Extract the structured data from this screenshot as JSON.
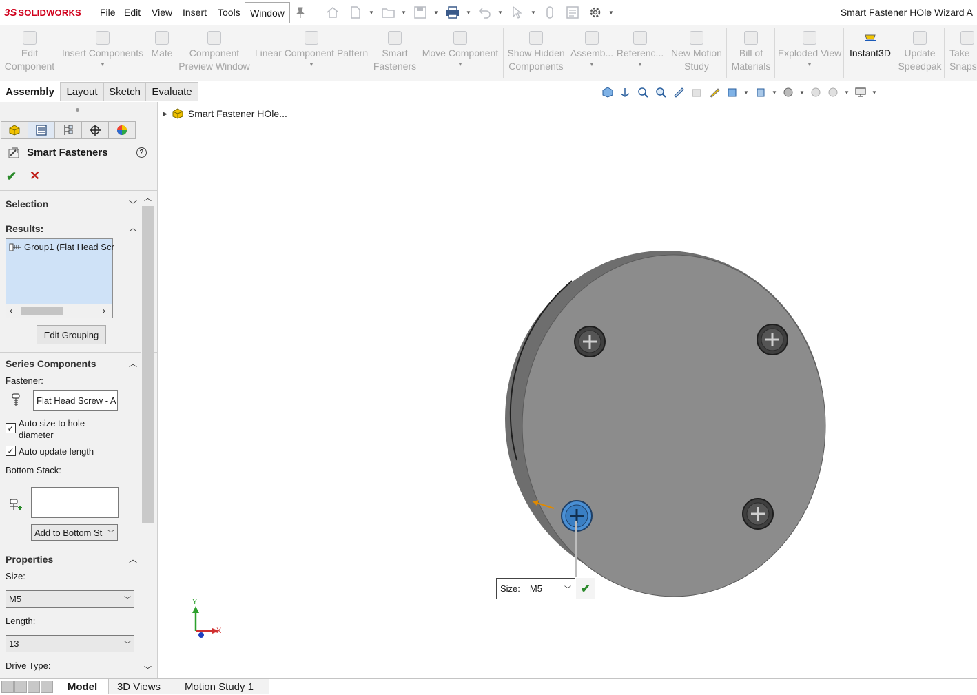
{
  "app": {
    "logo_ds": "3S",
    "logo_name": "SOLIDWORKS",
    "document_title": "Smart Fastener HOle Wizard A"
  },
  "menu": {
    "items": [
      "File",
      "Edit",
      "View",
      "Insert",
      "Tools"
    ],
    "window": "Window"
  },
  "ribbon": {
    "buttons": [
      {
        "label": "Edit\nComponent"
      },
      {
        "label": "Insert Components"
      },
      {
        "label": "Mate"
      },
      {
        "label": "Component\nPreview Window"
      },
      {
        "label": "Linear Component Pattern"
      },
      {
        "label": "Smart\nFasteners"
      },
      {
        "label": "Move Component"
      },
      {
        "label": "Show Hidden\nComponents"
      },
      {
        "label": "Assemb..."
      },
      {
        "label": "Referenc..."
      },
      {
        "label": "New Motion\nStudy"
      },
      {
        "label": "Bill of\nMaterials"
      },
      {
        "label": "Exploded View"
      },
      {
        "label": "Instant3D"
      },
      {
        "label": "Update\nSpeedpak"
      },
      {
        "label": "Take\nSnapsh"
      }
    ]
  },
  "command_tabs": [
    "Assembly",
    "Layout",
    "Sketch",
    "Evaluate"
  ],
  "property_manager": {
    "title": "Smart Fasteners",
    "help": "?",
    "selection": {
      "title": "Selection"
    },
    "results": {
      "title": "Results:",
      "items": [
        "Group1 (Flat Head Scr"
      ],
      "edit_grouping": "Edit Grouping"
    },
    "series": {
      "title": "Series Components",
      "fastener_label": "Fastener:",
      "fastener_value": "Flat Head Screw - A",
      "auto_size": "Auto size to hole\ndiameter",
      "auto_size_checked": true,
      "auto_update": "Auto update length",
      "auto_update_checked": true,
      "bottom_stack_label": "Bottom Stack:",
      "add_bottom": "Add to Bottom St"
    },
    "properties": {
      "title": "Properties",
      "size_label": "Size:",
      "size_value": "M5",
      "length_label": "Length:",
      "length_value": "13",
      "drive_label": "Drive Type:"
    }
  },
  "feature_tree": {
    "root": "Smart Fastener HOle..."
  },
  "callout": {
    "label": "Size:",
    "value": "M5"
  },
  "triad": {
    "x": "X",
    "y": "Y"
  },
  "bottom_tabs": [
    "Model",
    "3D Views",
    "Motion Study 1"
  ],
  "colors": {
    "accent": "#d0001c",
    "part_gray": "#8c8c8c",
    "selected_screw": "#4a8fd4",
    "ok_green": "#2b8a2b",
    "cancel_red": "#c0201a",
    "results_bg": "#cfe2f7"
  }
}
